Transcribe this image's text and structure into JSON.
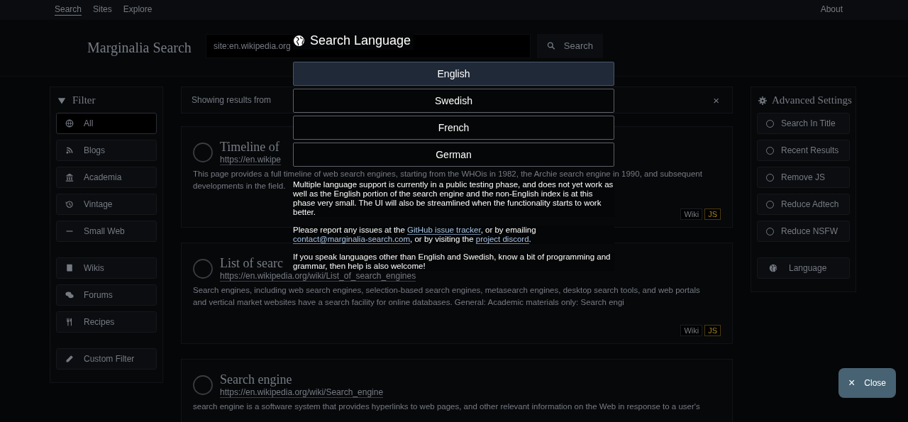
{
  "nav": {
    "links": [
      {
        "label": "Search",
        "selected": true
      },
      {
        "label": "Sites",
        "selected": false
      },
      {
        "label": "Explore",
        "selected": false
      }
    ],
    "about": "About"
  },
  "header": {
    "logo": "Marginalia Search",
    "search": {
      "value": "site:en.wikipedia.org"
    },
    "search_button": "Search"
  },
  "filter": {
    "title": "Filter",
    "groups": [
      [
        {
          "label": "All",
          "selected": true
        },
        {
          "label": "Blogs",
          "selected": false
        },
        {
          "label": "Academia",
          "selected": false
        },
        {
          "label": "Vintage",
          "selected": false
        },
        {
          "label": "Small Web",
          "selected": false
        }
      ],
      [
        {
          "label": "Wikis",
          "selected": false
        },
        {
          "label": "Forums",
          "selected": false
        },
        {
          "label": "Recipes",
          "selected": false
        }
      ],
      [
        {
          "label": "Custom Filter",
          "selected": false
        }
      ]
    ]
  },
  "notice": {
    "segments": [
      {
        "kind": "text",
        "text": "Showing results from"
      }
    ],
    "close": "×"
  },
  "results": [
    {
      "title": "Timeline of",
      "url": "https://en.wikipe",
      "snippet_lines": [
        "This page provides a full timeline of web search engines, starting from the WHOis in 1982, the Archie search engine in 1990, and subsequent",
        "developments in the field."
      ],
      "tags": [
        {
          "label": "Wiki",
          "kind": "plain"
        },
        {
          "label": "JS",
          "kind": "warning"
        }
      ]
    },
    {
      "title": "List of searc",
      "url": "https://en.wikipedia.org/wiki/List_of_search_engines",
      "snippet_lines": [
        "Search engines, including web search engines, selection-based search engines, metasearch engines, desktop search tools, and web portals",
        "and vertical market websites have a search facility for online databases. General: Academic materials only: Search engi"
      ],
      "tags": [
        {
          "label": "Wiki",
          "kind": "plain"
        },
        {
          "label": "JS",
          "kind": "warning"
        }
      ]
    },
    {
      "title": "Search engine",
      "url": "https://en.wikipedia.org/wiki/Search_engine",
      "snippet_lines": [
        "search engine is a software system that provides hyperlinks to web pages, and other relevant information on the Web in response to a user's"
      ]
    }
  ],
  "advanced": {
    "title": "Advanced Settings",
    "options": [
      {
        "label": "Search In Title",
        "checked": false
      },
      {
        "label": "Recent Results",
        "checked": false
      },
      {
        "label": "Remove JS",
        "checked": false
      },
      {
        "label": "Reduce Adtech",
        "checked": false
      },
      {
        "label": "Reduce NSFW",
        "checked": false
      }
    ],
    "language_button": "Language"
  },
  "modal": {
    "title": "Search Language",
    "languages": [
      {
        "label": "English",
        "selected": true
      },
      {
        "label": "Swedish",
        "selected": false
      },
      {
        "label": "French",
        "selected": false
      },
      {
        "label": "German",
        "selected": false
      }
    ],
    "paragraphs": [
      [
        {
          "kind": "text",
          "text": "Multiple language support is currently in a public testing phase, and does not yet work as well as the English portion of the search engine and the non-English index is at this phase very small. The UI will also be streamlined when the functionality starts to work better."
        }
      ],
      [
        {
          "kind": "text",
          "text": "Please report any issues at the "
        },
        {
          "kind": "link",
          "text": "GitHub issue tracker"
        },
        {
          "kind": "text",
          "text": ", or by emailing "
        },
        {
          "kind": "link",
          "text": "contact@marginalia-search.com"
        },
        {
          "kind": "text",
          "text": ", or by visiting the "
        },
        {
          "kind": "link",
          "text": "project discord"
        },
        {
          "kind": "text",
          "text": "."
        }
      ],
      [
        {
          "kind": "text",
          "text": "If you speak languages other than English and Swedish, know a bit of programming and grammar, then help is also welcome!"
        }
      ]
    ]
  },
  "close_button": {
    "icon": "×",
    "label": "Close"
  }
}
